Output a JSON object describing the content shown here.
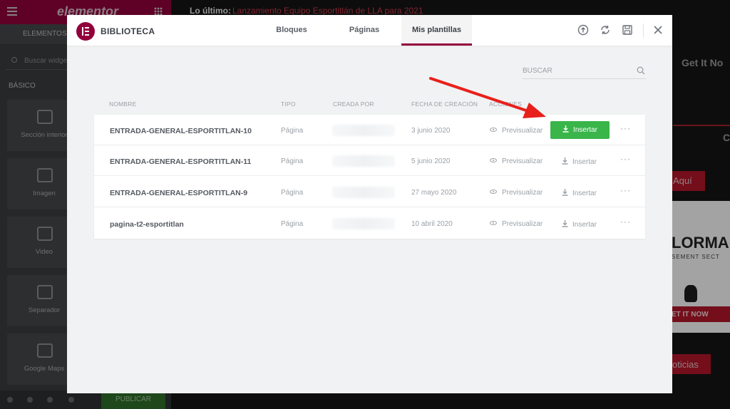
{
  "editor": {
    "logo": "elementor",
    "tabs": [
      "ELEMENTOS"
    ],
    "search_placeholder": "Buscar widget...",
    "section_label": "BÁSICO",
    "widgets": [
      "Sección interior",
      "Imagen",
      "Video",
      "Separador",
      "Google Maps"
    ],
    "publish_label": "PUBLICAR"
  },
  "site": {
    "news_label": "Lo último:",
    "news_link": "Lanzamiento Equipo Esportitlán de LLA para 2021",
    "get_it_now": "Get It No",
    "aqui": "Aquí",
    "promo_title": "LORMA",
    "promo_sub": "SEMENT SECT",
    "promo_button": "ET IT NOW",
    "noticias": "oticias",
    "circle_letter": "C"
  },
  "library": {
    "title": "BIBLIOTECA",
    "tabs": {
      "blocks": "Bloques",
      "pages": "Páginas",
      "my_templates": "Mis plantillas"
    },
    "search_placeholder": "BUSCAR",
    "columns": {
      "name": "NOMBRE",
      "type": "TIPO",
      "author": "CREADA POR",
      "date": "FECHA DE CREACIÓN",
      "actions": "ACCIONES"
    },
    "rows": [
      {
        "name": "ENTRADA-GENERAL-ESPORTITLAN-10",
        "type": "Página",
        "date": "3 junio 2020",
        "preview": "Previsualizar",
        "insert": "Insertar"
      },
      {
        "name": "ENTRADA-GENERAL-ESPORTITLAN-11",
        "type": "Página",
        "date": "5 junio 2020",
        "preview": "Previsualizar",
        "insert": "Insertar"
      },
      {
        "name": "ENTRADA-GENERAL-ESPORTITLAN-9",
        "type": "Página",
        "date": "27 mayo 2020",
        "preview": "Previsualizar",
        "insert": "Insertar"
      },
      {
        "name": "pagina-t2-esportitlan",
        "type": "Página",
        "date": "10 abril 2020",
        "preview": "Previsualizar",
        "insert": "Insertar"
      }
    ],
    "more_glyph": "···",
    "colors": {
      "brand": "#93003c",
      "insert_green": "#39b54a",
      "arrow": "#e8201c"
    },
    "icons": [
      "elementor-logo-icon",
      "upload-icon",
      "sync-icon",
      "save-icon",
      "close-icon",
      "search-icon",
      "eye-icon",
      "download-icon"
    ]
  }
}
